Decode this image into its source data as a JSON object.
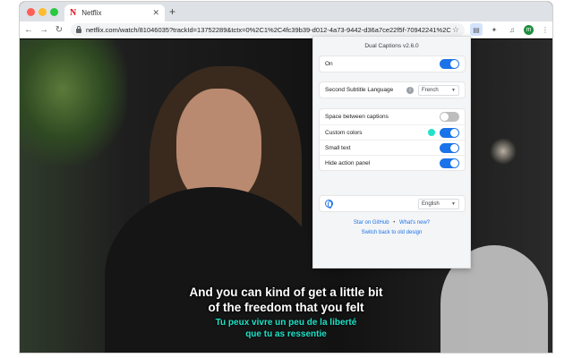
{
  "browser": {
    "tab_title": "Netflix",
    "tab_logo": "N",
    "url": "netflix.com/watch/81046035?trackId=13752289&tctx=0%2C1%2C4fc39b39-d012-4a73-9442-d36a7ce22f5f-70942241%2C",
    "profile_initial": "m",
    "icons": [
      "back-icon",
      "forward-icon",
      "reload-icon",
      "lock-icon",
      "star-icon",
      "dual-captions-extension-icon",
      "puzzle-icon",
      "media-icon",
      "menu-icon"
    ]
  },
  "subtitles": {
    "primary": [
      "And you can kind of get a little bit",
      "of the freedom that you felt"
    ],
    "secondary": [
      "Tu peux vivre un peu de la liberté",
      "que tu as ressentie"
    ],
    "secondary_color": "#1ee3c8"
  },
  "popup": {
    "title": "Dual Captions v2.6.0",
    "on_label": "On",
    "on_state": true,
    "second_language_label": "Second Subtitle Language",
    "second_language_value": "French",
    "space_between_label": "Space between captions",
    "space_between_state": false,
    "custom_colors_label": "Custom colors",
    "custom_colors_state": true,
    "custom_color": "#1ee3c8",
    "small_text_label": "Small text",
    "small_text_state": true,
    "hide_action_panel_label": "Hide action panel",
    "hide_action_panel_state": true,
    "ui_language_value": "English",
    "link_github": "Star on GitHub",
    "link_whats_new": "What's new?",
    "link_old_design": "Switch back to old design",
    "accent_color": "#1a73e8"
  }
}
